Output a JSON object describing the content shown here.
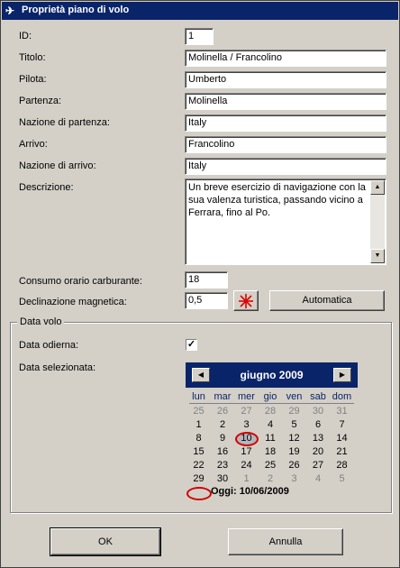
{
  "window": {
    "title": "Proprietà piano di volo",
    "icon": "plane-icon"
  },
  "form": {
    "id_label": "ID:",
    "id_value": "1",
    "titolo_label": "Titolo:",
    "titolo_value": "Molinella / Francolino",
    "pilota_label": "Pilota:",
    "pilota_value": "Umberto",
    "partenza_label": "Partenza:",
    "partenza_value": "Molinella",
    "nazione_partenza_label": "Nazione di partenza:",
    "nazione_partenza_value": "Italy",
    "arrivo_label": "Arrivo:",
    "arrivo_value": "Francolino",
    "nazione_arrivo_label": "Nazione di arrivo:",
    "nazione_arrivo_value": "Italy",
    "descrizione_label": "Descrizione:",
    "descrizione_value": "Un breve esercizio di navigazione con la sua valenza turistica, passando vicino a Ferrara, fino al Po.",
    "consumo_label": "Consumo orario carburante:",
    "consumo_value": "18",
    "declinazione_label": "Declinazione magnetica:",
    "declinazione_value": "0,5",
    "automatica_label": "Automatica"
  },
  "data_volo": {
    "legend": "Data volo",
    "odierna_label": "Data odierna:",
    "odierna_checked": true,
    "check_mark": "✓",
    "selezionata_label": "Data selezionata:"
  },
  "calendar": {
    "month_label": "giugno 2009",
    "prev_arrow": "◀",
    "next_arrow": "▶",
    "weekdays": [
      "lun",
      "mar",
      "mer",
      "gio",
      "ven",
      "sab",
      "dom"
    ],
    "weeks": [
      [
        "25",
        "26",
        "27",
        "28",
        "29",
        "30",
        "31"
      ],
      [
        "1",
        "2",
        "3",
        "4",
        "5",
        "6",
        "7"
      ],
      [
        "8",
        "9",
        "10",
        "11",
        "12",
        "13",
        "14"
      ],
      [
        "15",
        "16",
        "17",
        "18",
        "19",
        "20",
        "21"
      ],
      [
        "22",
        "23",
        "24",
        "25",
        "26",
        "27",
        "28"
      ],
      [
        "29",
        "30",
        "1",
        "2",
        "3",
        "4",
        "5"
      ]
    ],
    "selected_day": "10",
    "today_text": "Oggi: 10/06/2009",
    "accent_color": "#0a246a",
    "ring_color": "#d00000"
  },
  "buttons": {
    "ok": "OK",
    "cancel": "Annulla"
  }
}
